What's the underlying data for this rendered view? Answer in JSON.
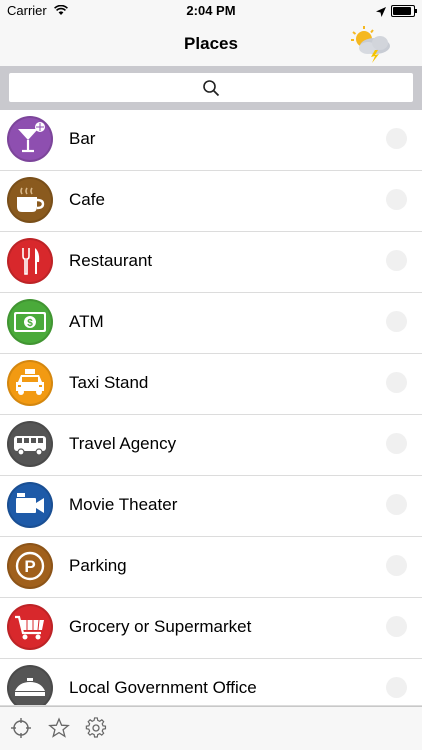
{
  "status_bar": {
    "carrier": "Carrier",
    "time": "2:04 PM"
  },
  "nav": {
    "title": "Places",
    "weather_icon": "partly-cloudy-thunder-icon"
  },
  "search": {
    "placeholder": "",
    "value": ""
  },
  "places": [
    {
      "label": "Bar",
      "icon": "cocktail-icon",
      "color": "#8e4fb0"
    },
    {
      "label": "Cafe",
      "icon": "coffee-cup-icon",
      "color": "#8a5a1e"
    },
    {
      "label": "Restaurant",
      "icon": "fork-knife-icon",
      "color": "#d8282c"
    },
    {
      "label": "ATM",
      "icon": "dollar-bill-icon",
      "color": "#4aaa3a"
    },
    {
      "label": "Taxi Stand",
      "icon": "taxi-icon",
      "color": "#f29a12"
    },
    {
      "label": "Travel Agency",
      "icon": "bus-icon",
      "color": "#555555"
    },
    {
      "label": "Movie Theater",
      "icon": "video-camera-icon",
      "color": "#1e5aa8"
    },
    {
      "label": "Parking",
      "icon": "parking-icon",
      "color": "#a0601c"
    },
    {
      "label": "Grocery or Supermarket",
      "icon": "shopping-cart-icon",
      "color": "#d8282c"
    },
    {
      "label": "Local Government Office",
      "icon": "government-building-icon",
      "color": "#555555"
    }
  ],
  "toolbar": {
    "items": [
      "locate-icon",
      "favorites-star-icon",
      "settings-gear-icon"
    ]
  }
}
